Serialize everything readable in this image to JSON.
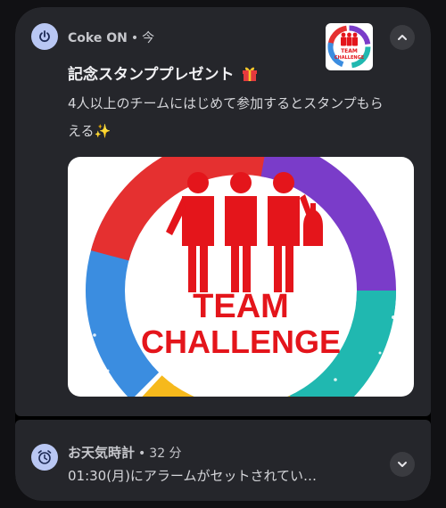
{
  "notifications": [
    {
      "app_name": "Coke ON",
      "time": "今",
      "separator": "•",
      "icon": "power-icon",
      "title": "記念スタンププレゼント",
      "title_emoji": "gift-emoji",
      "message": "4人以上のチームにはじめて参加するとスタンプもらえる✨",
      "image_text_line1": "TEAM",
      "image_text_line2": "CHALLENGE",
      "thumb_text_line1": "TEAM",
      "thumb_text_line2": "CHALLENGE",
      "expand_icon": "chevron-up-icon"
    },
    {
      "app_name": "お天気時計",
      "time": "32 分",
      "separator": "•",
      "icon": "alarm-clock-icon",
      "message": "01:30(月)にアラームがセットされてい…",
      "expand_icon": "chevron-down-icon"
    }
  ],
  "colors": {
    "card_bg": "#25262b",
    "icon_bg": "#b9c7f3",
    "ring_red": "#e53030",
    "ring_purple": "#7a3cc9",
    "ring_teal": "#20b8b0",
    "ring_yellow": "#f6b91c",
    "ring_blue": "#3b8de0",
    "team_red": "#e4151b"
  }
}
